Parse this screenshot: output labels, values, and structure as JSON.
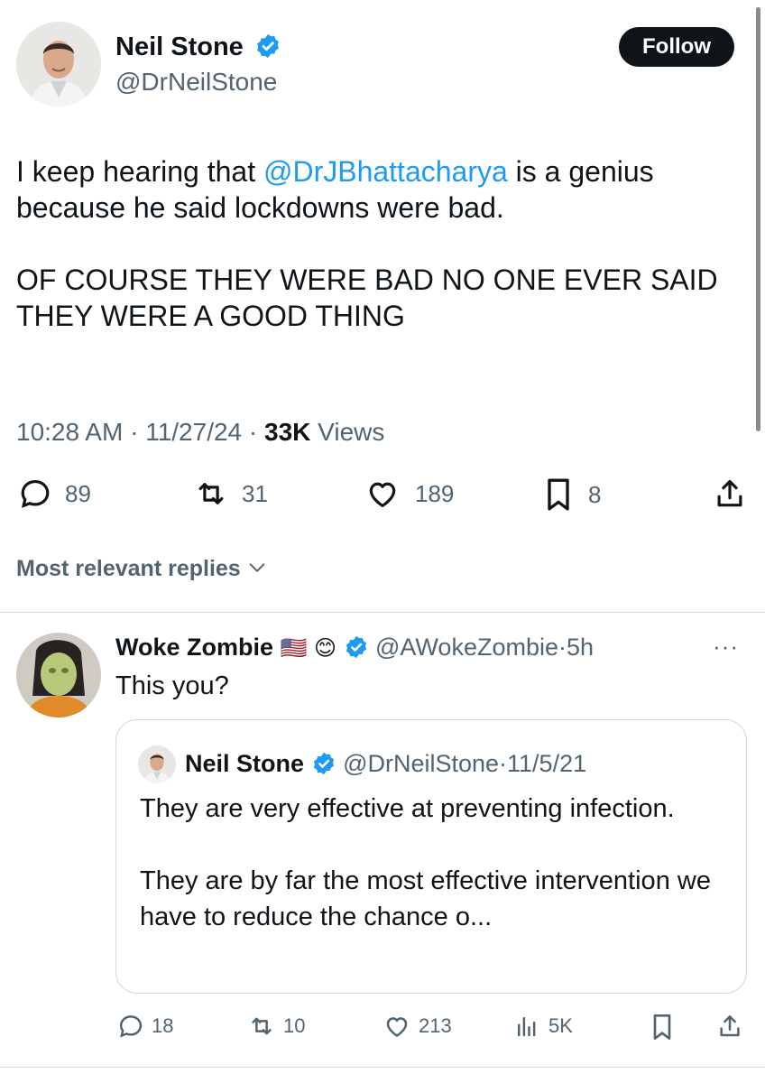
{
  "tweet": {
    "author_name": "Neil Stone",
    "handle": "@DrNeilStone",
    "follow_label": "Follow",
    "text_before_mention": "I keep hearing that ",
    "mention": "@DrJBhattacharya",
    "text_after_mention": " is a genius because he said lockdowns were bad.",
    "text_paragraph_2": "OF COURSE THEY WERE BAD NO ONE EVER SAID THEY WERE A GOOD THING",
    "time": "10:28 AM",
    "date": "11/27/24",
    "views_count": "33K",
    "views_label": "Views",
    "replies": "89",
    "reposts": "31",
    "likes": "189",
    "bookmarks": "8"
  },
  "replies_filter": {
    "label": "Most relevant replies"
  },
  "reply": {
    "author_name": "Woke Zombie",
    "emoji_flag": "🇺🇸",
    "emoji_smile": "😊",
    "handle": "@AWokeZombie",
    "time": "5h",
    "more": "···",
    "text": "This you?",
    "replies": "18",
    "reposts": "10",
    "likes": "213",
    "views": "5K"
  },
  "quoted": {
    "author_name": "Neil Stone",
    "handle": "@DrNeilStone",
    "date": "11/5/21",
    "text_1": "They are very effective at preventing infection.",
    "text_2": "They are by far the most effective intervention we have to reduce the chance o..."
  },
  "separator": "·",
  "colors": {
    "verified": "#1d9bf0",
    "link": "#1d9bf0",
    "muted": "#536471",
    "text": "#0f1419"
  }
}
